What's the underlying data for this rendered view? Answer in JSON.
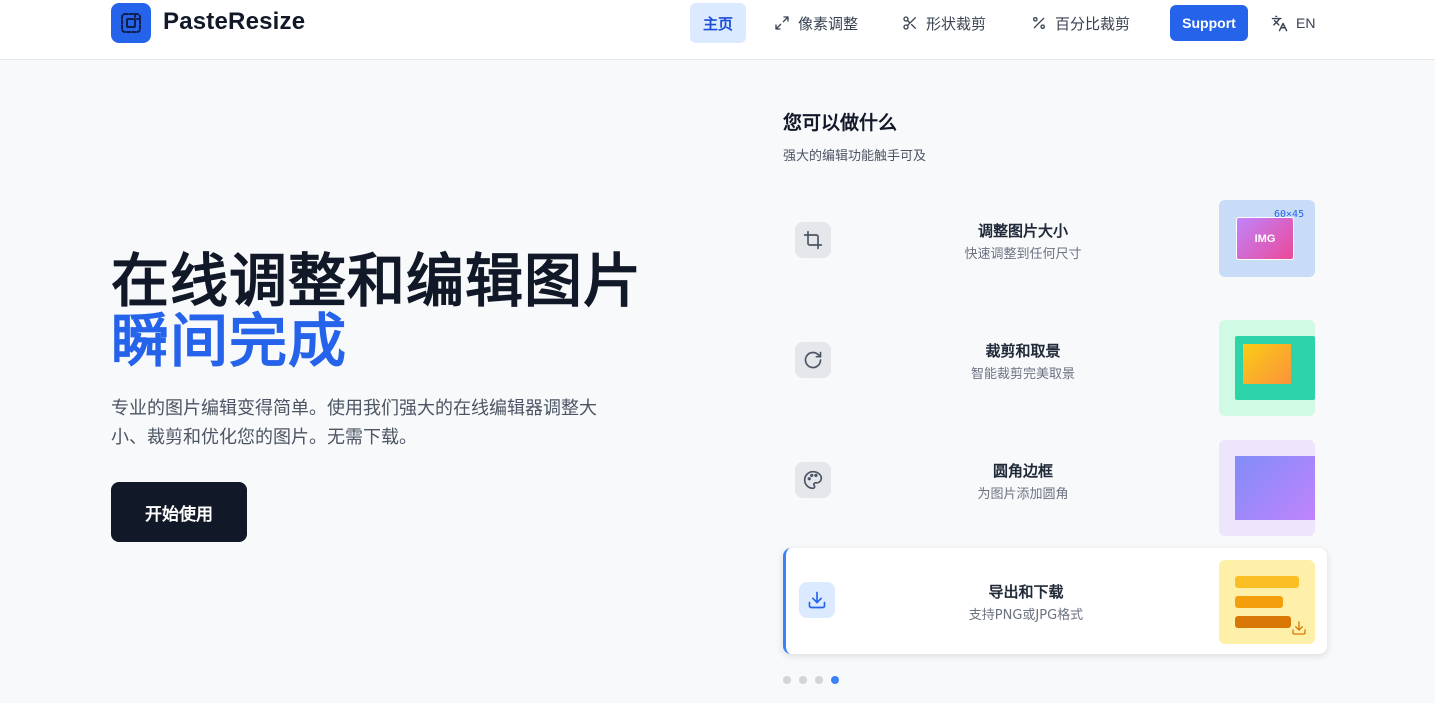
{
  "header": {
    "brand": "PasteResize",
    "nav": {
      "home": "主页",
      "pixel_resize": "像素调整",
      "shape_crop": "形状裁剪",
      "percent_crop": "百分比裁剪"
    },
    "support_label": "Support",
    "language": "EN"
  },
  "hero": {
    "title_line1": "在线调整和编辑图片",
    "title_line2": "瞬间完成",
    "description": "专业的图片编辑变得简单。使用我们强大的在线编辑器调整大小、裁剪和优化您的图片。无需下载。",
    "cta_label": "开始使用"
  },
  "features_panel": {
    "title": "您可以做什么",
    "subtitle": "强大的编辑功能触手可及",
    "items": [
      {
        "title": "调整图片大小",
        "desc": "快速调整到任何尺寸",
        "icon": "crop-icon",
        "thumb_img_label": "IMG",
        "thumb_size_label": "60×45"
      },
      {
        "title": "裁剪和取景",
        "desc": "智能裁剪完美取景",
        "icon": "rotate-icon"
      },
      {
        "title": "圆角边框",
        "desc": "为图片添加圆角",
        "icon": "palette-icon"
      },
      {
        "title": "导出和下载",
        "desc": "支持PNG或JPG格式",
        "icon": "download-icon"
      }
    ],
    "active_index": 3
  },
  "colors": {
    "brand_blue": "#2563eb",
    "dark": "#111827",
    "nav_active_bg": "#dbeafe"
  }
}
